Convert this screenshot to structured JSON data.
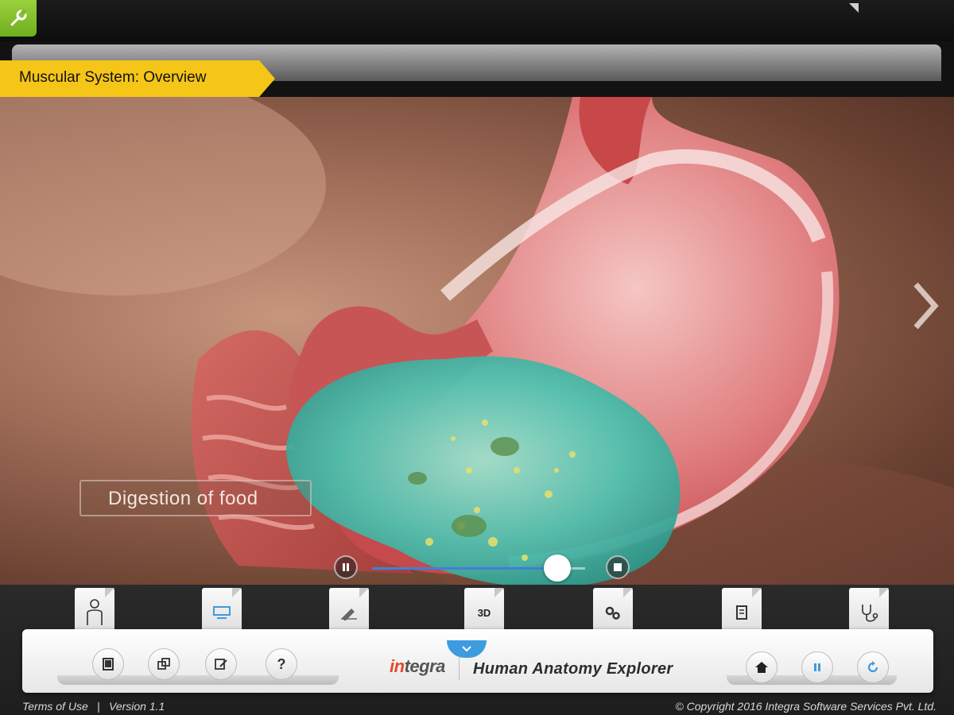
{
  "header": {
    "title": "Muscular System: Overview",
    "wrench_icon": "wrench-icon",
    "accent_green": "#8cc63f",
    "title_tag_color": "#f5c518"
  },
  "stage": {
    "label": "Digestion of food",
    "next_icon": "chevron-right-icon",
    "player": {
      "pause_icon": "pause-icon",
      "stop_icon": "stop-icon",
      "progress_fraction": 0.87,
      "progress_color": "#3f7fd9"
    }
  },
  "dock": {
    "tabs": [
      {
        "icon": "body-outline-icon",
        "text": ""
      },
      {
        "icon": "notes-icon",
        "text": ""
      },
      {
        "icon": "edit-pencil-icon",
        "text": ""
      },
      {
        "icon": "3d-icon",
        "text": "3D"
      },
      {
        "icon": "gears-icon",
        "text": ""
      },
      {
        "icon": "document-icon",
        "text": ""
      },
      {
        "icon": "stethoscope-icon",
        "text": ""
      }
    ],
    "left_buttons": [
      {
        "icon": "tablet-icon",
        "text": ""
      },
      {
        "icon": "copy-icon",
        "text": ""
      },
      {
        "icon": "note-edit-icon",
        "text": ""
      },
      {
        "icon": "help-icon",
        "text": "?"
      }
    ],
    "brand": "integra",
    "app_name": "Human Anatomy Explorer",
    "expand_icon": "chevron-down-icon",
    "right_buttons": [
      {
        "icon": "home-icon"
      },
      {
        "icon": "pause-icon"
      },
      {
        "icon": "refresh-icon"
      }
    ]
  },
  "footer": {
    "terms": "Terms of Use",
    "separator": "|",
    "version": "Version 1.1",
    "copyright": "© Copyright 2016 Integra Software Services Pvt. Ltd."
  }
}
